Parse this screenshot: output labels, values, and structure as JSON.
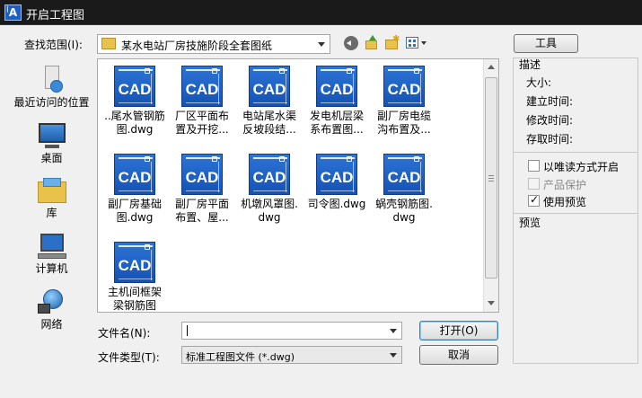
{
  "window": {
    "title": "开启工程图",
    "app_icon_letter": "A"
  },
  "lookin": {
    "label": "查找范围(I):",
    "value": "某水电站厂房技施阶段全套图纸"
  },
  "places": [
    {
      "label": "最近访问的位置"
    },
    {
      "label": "桌面"
    },
    {
      "label": "库"
    },
    {
      "label": "计算机"
    },
    {
      "label": "网络"
    }
  ],
  "files": [
    {
      "name": "..尾水管钢筋图.dwg",
      "line1": "..尾水管钢筋",
      "line2": "图.dwg"
    },
    {
      "name": "厂区平面布置及开挖...",
      "line1": "厂区平面布",
      "line2": "置及开挖..."
    },
    {
      "name": "电站尾水渠反坡段结...",
      "line1": "电站尾水渠",
      "line2": "反坡段结..."
    },
    {
      "name": "发电机层梁系布置图...",
      "line1": "发电机层梁",
      "line2": "系布置图..."
    },
    {
      "name": "副厂房电缆沟布置及...",
      "line1": "副厂房电缆",
      "line2": "沟布置及..."
    },
    {
      "name": "副厂房基础图.dwg",
      "line1": "副厂房基础",
      "line2": "图.dwg"
    },
    {
      "name": "副厂房平面布置、屋...",
      "line1": "副厂房平面",
      "line2": "布置、屋..."
    },
    {
      "name": "机墩风罩图.dwg",
      "line1": "机墩风罩图.",
      "line2": "dwg"
    },
    {
      "name": "司令图.dwg",
      "line1": "司令图.dwg",
      "line2": ""
    },
    {
      "name": "蜗壳钢筋图.dwg",
      "line1": "蜗壳钢筋图.",
      "line2": "dwg"
    },
    {
      "name": "主机间框架梁钢筋图",
      "line1": "主机间框架",
      "line2": "梁钢筋图"
    }
  ],
  "file_icon_text": "CAD",
  "filename": {
    "label": "文件名(N):",
    "value": ""
  },
  "filetype": {
    "label": "文件类型(T):",
    "value": "标准工程图文件 (*.dwg)"
  },
  "buttons": {
    "open": "打开(O)",
    "cancel": "取消",
    "tools": "工具"
  },
  "desc": {
    "title": "描述",
    "size": "大小:",
    "created": "建立时间:",
    "modified": "修改时间:",
    "accessed": "存取时间:"
  },
  "options": {
    "readonly": "以唯读方式开启",
    "protect": "产品保护",
    "preview": "使用预览"
  },
  "preview_title": "预览",
  "colors": {
    "cad_blue": "#1e64c8",
    "title_bg": "#1a1a1a",
    "accent": "#f0f0f0"
  }
}
